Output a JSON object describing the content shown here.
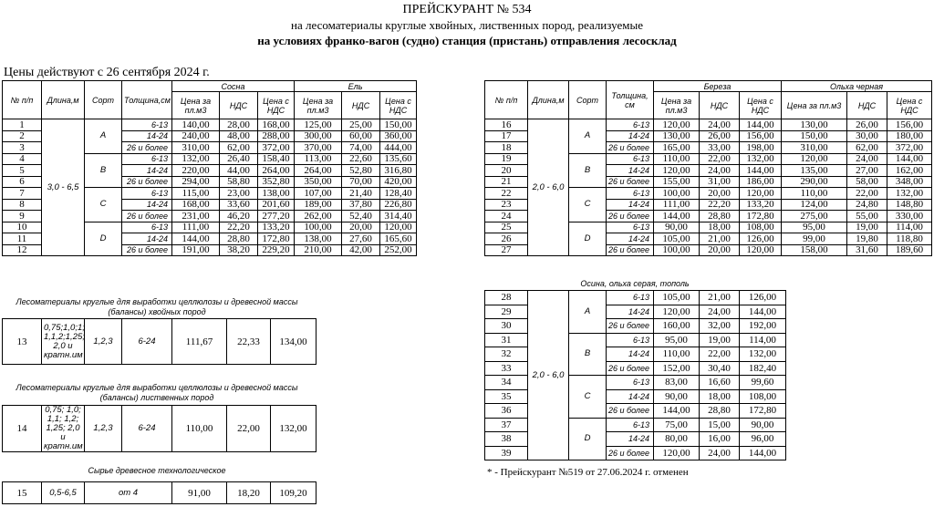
{
  "header": {
    "title": "ПРЕЙСКУРАНТ № 534",
    "subtitle": "на лесоматериалы круглые хвойных, лиственных пород, реализуемые",
    "subtitle2": "на условиях франко-вагон (судно) станция (пристань) отправления лесосклад",
    "prices_date": "Цены действуют с 26 сентября 2024 г."
  },
  "left_table": {
    "headers": {
      "num": "№ п/п",
      "length": "Длина,м",
      "grade": "Сорт",
      "thickness": "Толщина,см",
      "species1": "Сосна",
      "species2": "Ель",
      "price_per": "Цена за пл.м3",
      "vat": "НДС",
      "price_vat": "Цена с НДС"
    },
    "length": "3,0 - 6,5",
    "grades": [
      "А",
      "В",
      "С",
      "D"
    ],
    "rows": [
      {
        "num": "1",
        "thick": "6-13",
        "v": [
          "140,00",
          "28,00",
          "168,00",
          "125,00",
          "25,00",
          "150,00"
        ]
      },
      {
        "num": "2",
        "thick": "14-24",
        "v": [
          "240,00",
          "48,00",
          "288,00",
          "300,00",
          "60,00",
          "360,00"
        ]
      },
      {
        "num": "3",
        "thick": "26 и более",
        "v": [
          "310,00",
          "62,00",
          "372,00",
          "370,00",
          "74,00",
          "444,00"
        ]
      },
      {
        "num": "4",
        "thick": "6-13",
        "v": [
          "132,00",
          "26,40",
          "158,40",
          "113,00",
          "22,60",
          "135,60"
        ]
      },
      {
        "num": "5",
        "thick": "14-24",
        "v": [
          "220,00",
          "44,00",
          "264,00",
          "264,00",
          "52,80",
          "316,80"
        ]
      },
      {
        "num": "6",
        "thick": "26 и более",
        "v": [
          "294,00",
          "58,80",
          "352,80",
          "350,00",
          "70,00",
          "420,00"
        ]
      },
      {
        "num": "7",
        "thick": "6-13",
        "v": [
          "115,00",
          "23,00",
          "138,00",
          "107,00",
          "21,40",
          "128,40"
        ]
      },
      {
        "num": "8",
        "thick": "14-24",
        "v": [
          "168,00",
          "33,60",
          "201,60",
          "189,00",
          "37,80",
          "226,80"
        ]
      },
      {
        "num": "9",
        "thick": "26 и более",
        "v": [
          "231,00",
          "46,20",
          "277,20",
          "262,00",
          "52,40",
          "314,40"
        ]
      },
      {
        "num": "10",
        "thick": "6-13",
        "v": [
          "111,00",
          "22,20",
          "133,20",
          "100,00",
          "20,00",
          "120,00"
        ]
      },
      {
        "num": "11",
        "thick": "14-24",
        "v": [
          "144,00",
          "28,80",
          "172,80",
          "138,00",
          "27,60",
          "165,60"
        ]
      },
      {
        "num": "12",
        "thick": "26 и более",
        "v": [
          "191,00",
          "38,20",
          "229,20",
          "210,00",
          "42,00",
          "252,00"
        ]
      }
    ]
  },
  "right_table": {
    "headers": {
      "num": "№ п/п",
      "length": "Длина,м",
      "grade": "Сорт",
      "thickness": "Толщина, см",
      "species1": "Береза",
      "species2": "Ольха черная",
      "price_per": "Цена за пл.м3",
      "price_per2": "Цена за пл.м3",
      "vat": "НДС",
      "price_vat": "Цена с НДС"
    },
    "length": "2,0 - 6,0",
    "grades": [
      "А",
      "В",
      "С",
      "D"
    ],
    "rows": [
      {
        "num": "16",
        "thick": "6-13",
        "v": [
          "120,00",
          "24,00",
          "144,00",
          "130,00",
          "26,00",
          "156,00"
        ]
      },
      {
        "num": "17",
        "thick": "14-24",
        "v": [
          "130,00",
          "26,00",
          "156,00",
          "150,00",
          "30,00",
          "180,00"
        ]
      },
      {
        "num": "18",
        "thick": "26 и более",
        "v": [
          "165,00",
          "33,00",
          "198,00",
          "310,00",
          "62,00",
          "372,00"
        ]
      },
      {
        "num": "19",
        "thick": "6-13",
        "v": [
          "110,00",
          "22,00",
          "132,00",
          "120,00",
          "24,00",
          "144,00"
        ]
      },
      {
        "num": "20",
        "thick": "14-24",
        "v": [
          "120,00",
          "24,00",
          "144,00",
          "135,00",
          "27,00",
          "162,00"
        ]
      },
      {
        "num": "21",
        "thick": "26 и более",
        "v": [
          "155,00",
          "31,00",
          "186,00",
          "290,00",
          "58,00",
          "348,00"
        ]
      },
      {
        "num": "22",
        "thick": "6-13",
        "v": [
          "100,00",
          "20,00",
          "120,00",
          "110,00",
          "22,00",
          "132,00"
        ]
      },
      {
        "num": "23",
        "thick": "14-24",
        "v": [
          "111,00",
          "22,20",
          "133,20",
          "124,00",
          "24,80",
          "148,80"
        ]
      },
      {
        "num": "24",
        "thick": "26 и более",
        "v": [
          "144,00",
          "28,80",
          "172,80",
          "275,00",
          "55,00",
          "330,00"
        ]
      },
      {
        "num": "25",
        "thick": "6-13",
        "v": [
          "90,00",
          "18,00",
          "108,00",
          "95,00",
          "19,00",
          "114,00"
        ]
      },
      {
        "num": "26",
        "thick": "14-24",
        "v": [
          "105,00",
          "21,00",
          "126,00",
          "99,00",
          "19,80",
          "118,80"
        ]
      },
      {
        "num": "27",
        "thick": "26 и более",
        "v": [
          "100,00",
          "20,00",
          "120,00",
          "158,00",
          "31,60",
          "189,60"
        ]
      }
    ]
  },
  "aspen_table": {
    "caption": "Осина, ольха серая, тополь",
    "length": "2,0 - 6,0",
    "grades": [
      "А",
      "В",
      "С",
      "D"
    ],
    "rows": [
      {
        "num": "28",
        "thick": "6-13",
        "v": [
          "105,00",
          "21,00",
          "126,00"
        ]
      },
      {
        "num": "29",
        "thick": "14-24",
        "v": [
          "120,00",
          "24,00",
          "144,00"
        ]
      },
      {
        "num": "30",
        "thick": "26 и более",
        "v": [
          "160,00",
          "32,00",
          "192,00"
        ]
      },
      {
        "num": "31",
        "thick": "6-13",
        "v": [
          "95,00",
          "19,00",
          "114,00"
        ]
      },
      {
        "num": "32",
        "thick": "14-24",
        "v": [
          "110,00",
          "22,00",
          "132,00"
        ]
      },
      {
        "num": "33",
        "thick": "26 и более",
        "v": [
          "152,00",
          "30,40",
          "182,40"
        ]
      },
      {
        "num": "34",
        "thick": "6-13",
        "v": [
          "83,00",
          "16,60",
          "99,60"
        ]
      },
      {
        "num": "35",
        "thick": "14-24",
        "v": [
          "90,00",
          "18,00",
          "108,00"
        ]
      },
      {
        "num": "36",
        "thick": "26 и более",
        "v": [
          "144,00",
          "28,80",
          "172,80"
        ]
      },
      {
        "num": "37",
        "thick": "6-13",
        "v": [
          "75,00",
          "15,00",
          "90,00"
        ]
      },
      {
        "num": "38",
        "thick": "14-24",
        "v": [
          "80,00",
          "16,00",
          "96,00"
        ]
      },
      {
        "num": "39",
        "thick": "26 и более",
        "v": [
          "120,00",
          "24,00",
          "144,00"
        ]
      }
    ]
  },
  "pulp_conifer": {
    "caption": "Лесоматериалы круглые для выработки целлюлозы и древесной массы (балансы) хвойных пород",
    "num": "13",
    "length": "0,75;1,0;1; 1,1,2;1,25; 2,0 и кратн.им",
    "grade": "1,2,3",
    "thick": "6-24",
    "v": [
      "111,67",
      "22,33",
      "134,00"
    ]
  },
  "pulp_deciduous": {
    "caption": "Лесоматериалы круглые для выработки целлюлозы и древесной массы (балансы) лиственных пород",
    "num": "14",
    "length": "0,75; 1,0; 1,1; 1,2; 1,25; 2,0 и кратн.им",
    "grade": "1,2,3",
    "thick": "6-24",
    "v": [
      "110,00",
      "22,00",
      "132,00"
    ]
  },
  "tech_raw": {
    "caption": "Сырье древесное технологическое",
    "num": "15",
    "length": "0,5-6,5",
    "thick": "от 4",
    "v": [
      "91,00",
      "18,20",
      "109,20"
    ]
  },
  "footnote": "* - Прейскурант №519 от 27.06.2024 г. отменен"
}
